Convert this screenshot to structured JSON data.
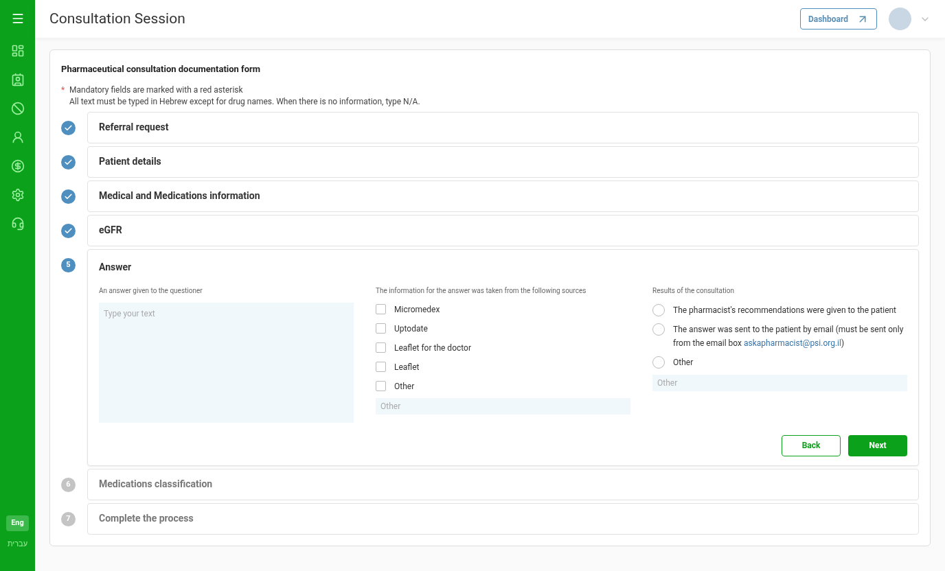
{
  "header": {
    "title": "Consultation Session",
    "dashboard_button": "Dashboard"
  },
  "sidebar": {
    "languages": [
      {
        "label": "Eng",
        "selected": true
      },
      {
        "label": "עברית",
        "selected": false
      }
    ]
  },
  "form": {
    "title": "Pharmaceutical consultation documentation form",
    "asterisk": "*",
    "note_lines": [
      "Mandatory fields are marked with a red asterisk",
      "All text must be typed in Hebrew except for drug names. When there is no information, type N/A."
    ],
    "steps": [
      {
        "title": "Referral request",
        "completed": true,
        "active": false
      },
      {
        "title": "Patient details",
        "completed": true,
        "active": false
      },
      {
        "title": "Medical and Medications information",
        "completed": true,
        "active": false
      },
      {
        "title": "eGFR",
        "completed": true,
        "active": false
      },
      {
        "number": "5",
        "title": "Answer",
        "completed": false,
        "active": true
      },
      {
        "number": "6",
        "title": "Medications classification",
        "completed": false,
        "active": false
      },
      {
        "number": "7",
        "title": "Complete the process",
        "completed": false,
        "active": false
      }
    ],
    "answer": {
      "answer_label": "An answer given to the questioner",
      "answer_placeholder": "Type your text",
      "sources_label": "The information for the answer was taken from the following sources",
      "sources": [
        {
          "label": "Micromedex",
          "checked": false
        },
        {
          "label": "Uptodate",
          "checked": false
        },
        {
          "label": "Leaflet for the doctor",
          "checked": false
        },
        {
          "label": "Leaflet",
          "checked": false
        },
        {
          "label": "Other",
          "checked": false
        }
      ],
      "sources_other_placeholder": "Other",
      "results_label": "Results of the consultation",
      "results": [
        {
          "label": "The pharmacist's recommendations were given to the patient",
          "selected": false
        },
        {
          "label": "The answer was sent to the patient by email (must be sent only from the email box",
          "link": "askapharmacist@psi.org.il",
          "label_end": ")",
          "selected": false
        },
        {
          "label": "Other",
          "selected": false
        }
      ],
      "results_other_placeholder": "Other",
      "back": "Back",
      "next": "Next"
    }
  }
}
